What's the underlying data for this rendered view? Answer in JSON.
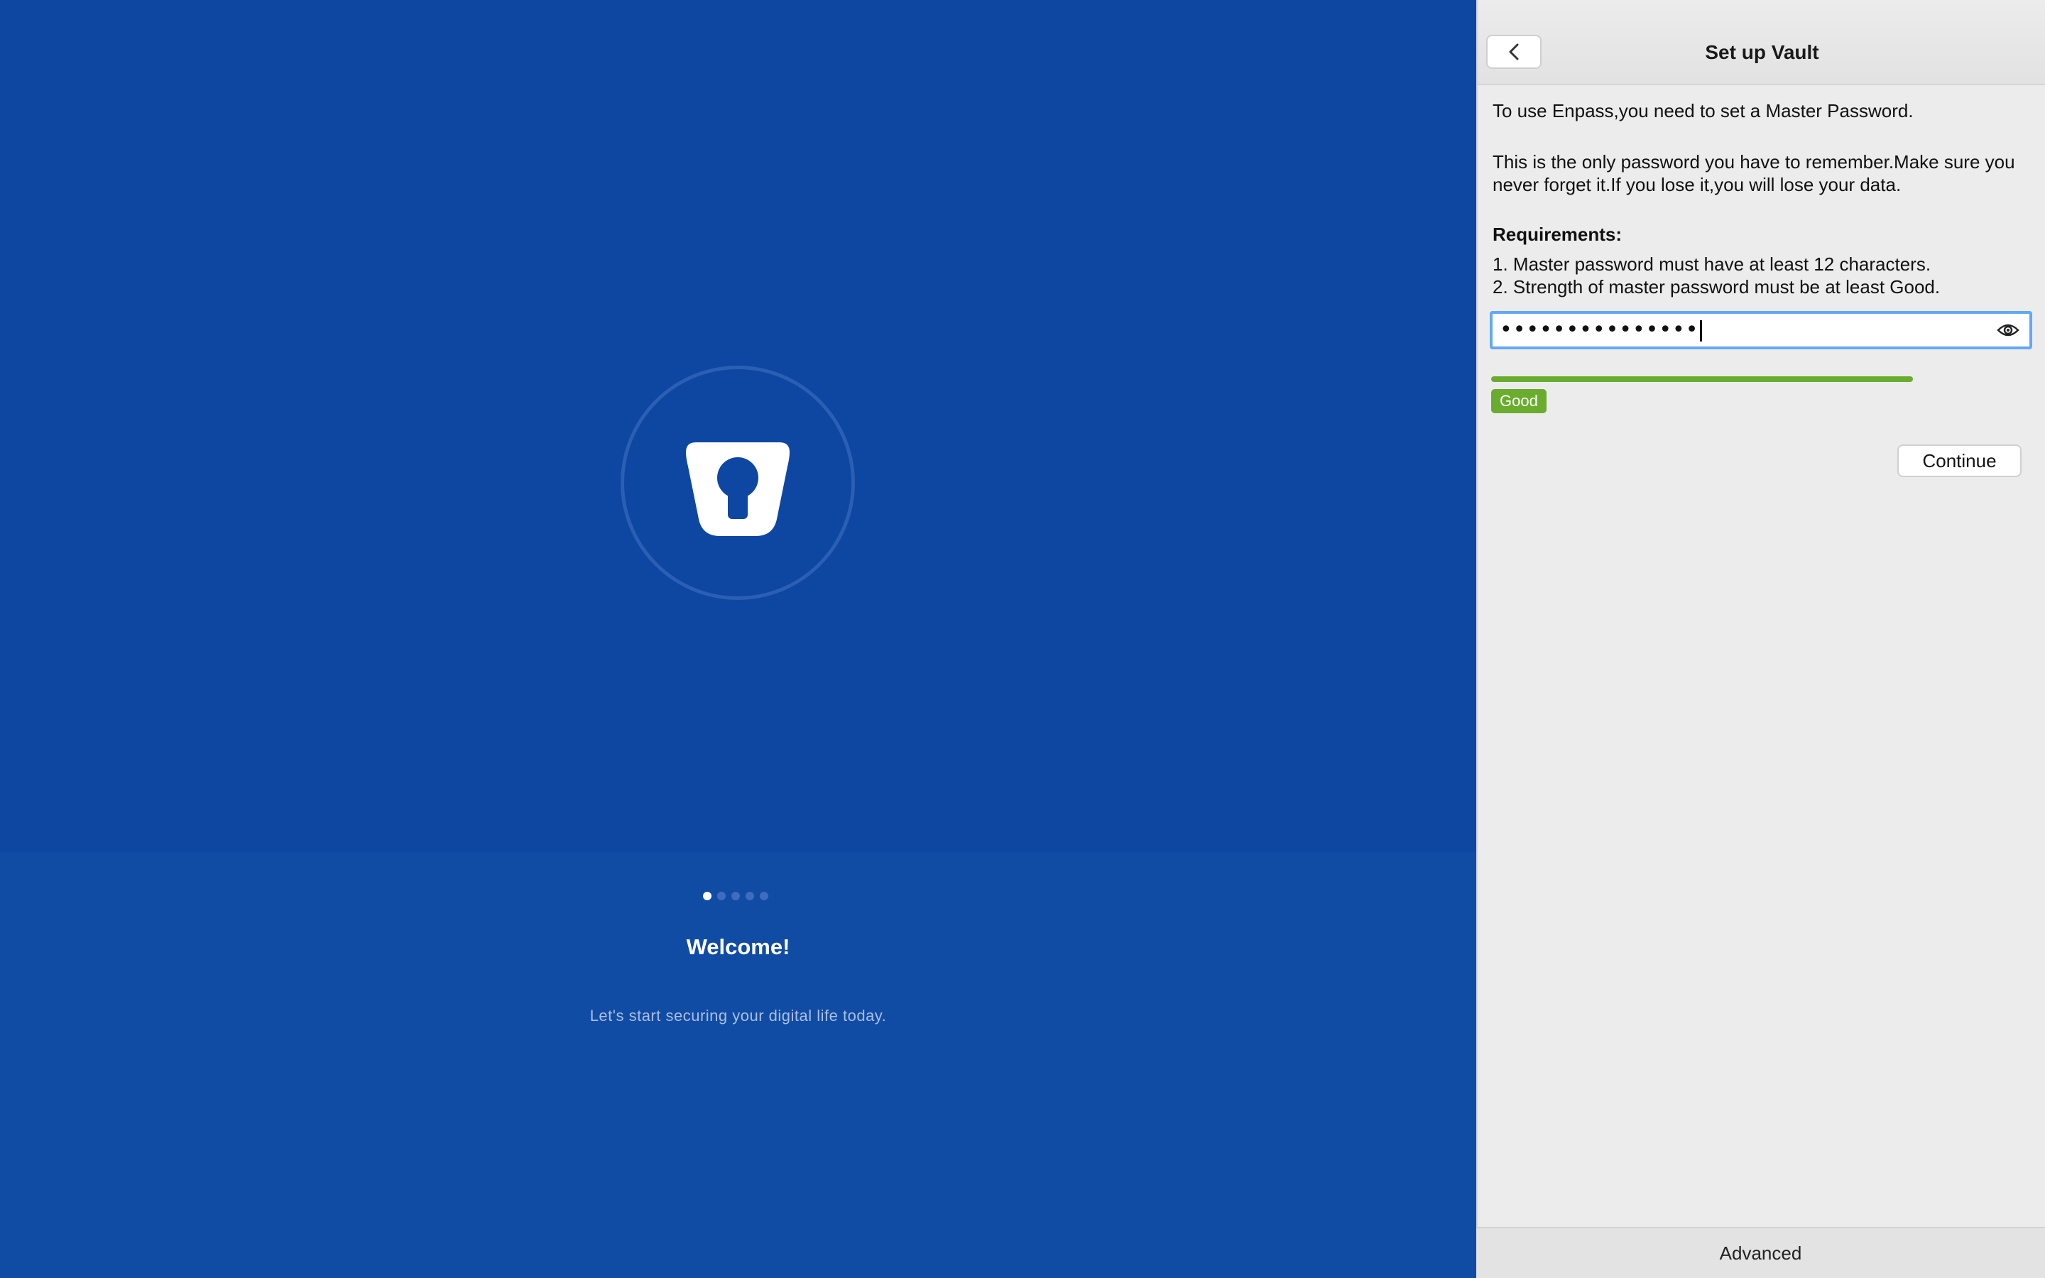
{
  "welcome": {
    "title": "Welcome!",
    "subtitle": "Let's start securing your digital life today.",
    "carousel": {
      "count": 5,
      "active_index": 0
    },
    "logo_icon": "enpass-keyhole-icon"
  },
  "setup": {
    "title": "Set up Vault",
    "back_icon": "chevron-left-icon",
    "intro": "To use Enpass,you need to set a Master Password.",
    "warning": "This is the only password you have to remember.Make sure you never forget it.If you lose it,you will lose your data.",
    "requirements_title": "Requirements:",
    "requirements": [
      "1. Master password must have at least 12 characters.",
      "2. Strength of master password must be at least Good."
    ],
    "password": {
      "masked_value": "•••••••••••••••",
      "reveal_icon": "eye-icon"
    },
    "strength": {
      "label": "Good",
      "fraction": 0.78,
      "color": "#6aac2e"
    },
    "continue_label": "Continue",
    "advanced_label": "Advanced"
  },
  "colors": {
    "brand_blue": "#0e47a2",
    "focus_ring": "#63a8f5",
    "strength_green": "#6aac2e"
  }
}
